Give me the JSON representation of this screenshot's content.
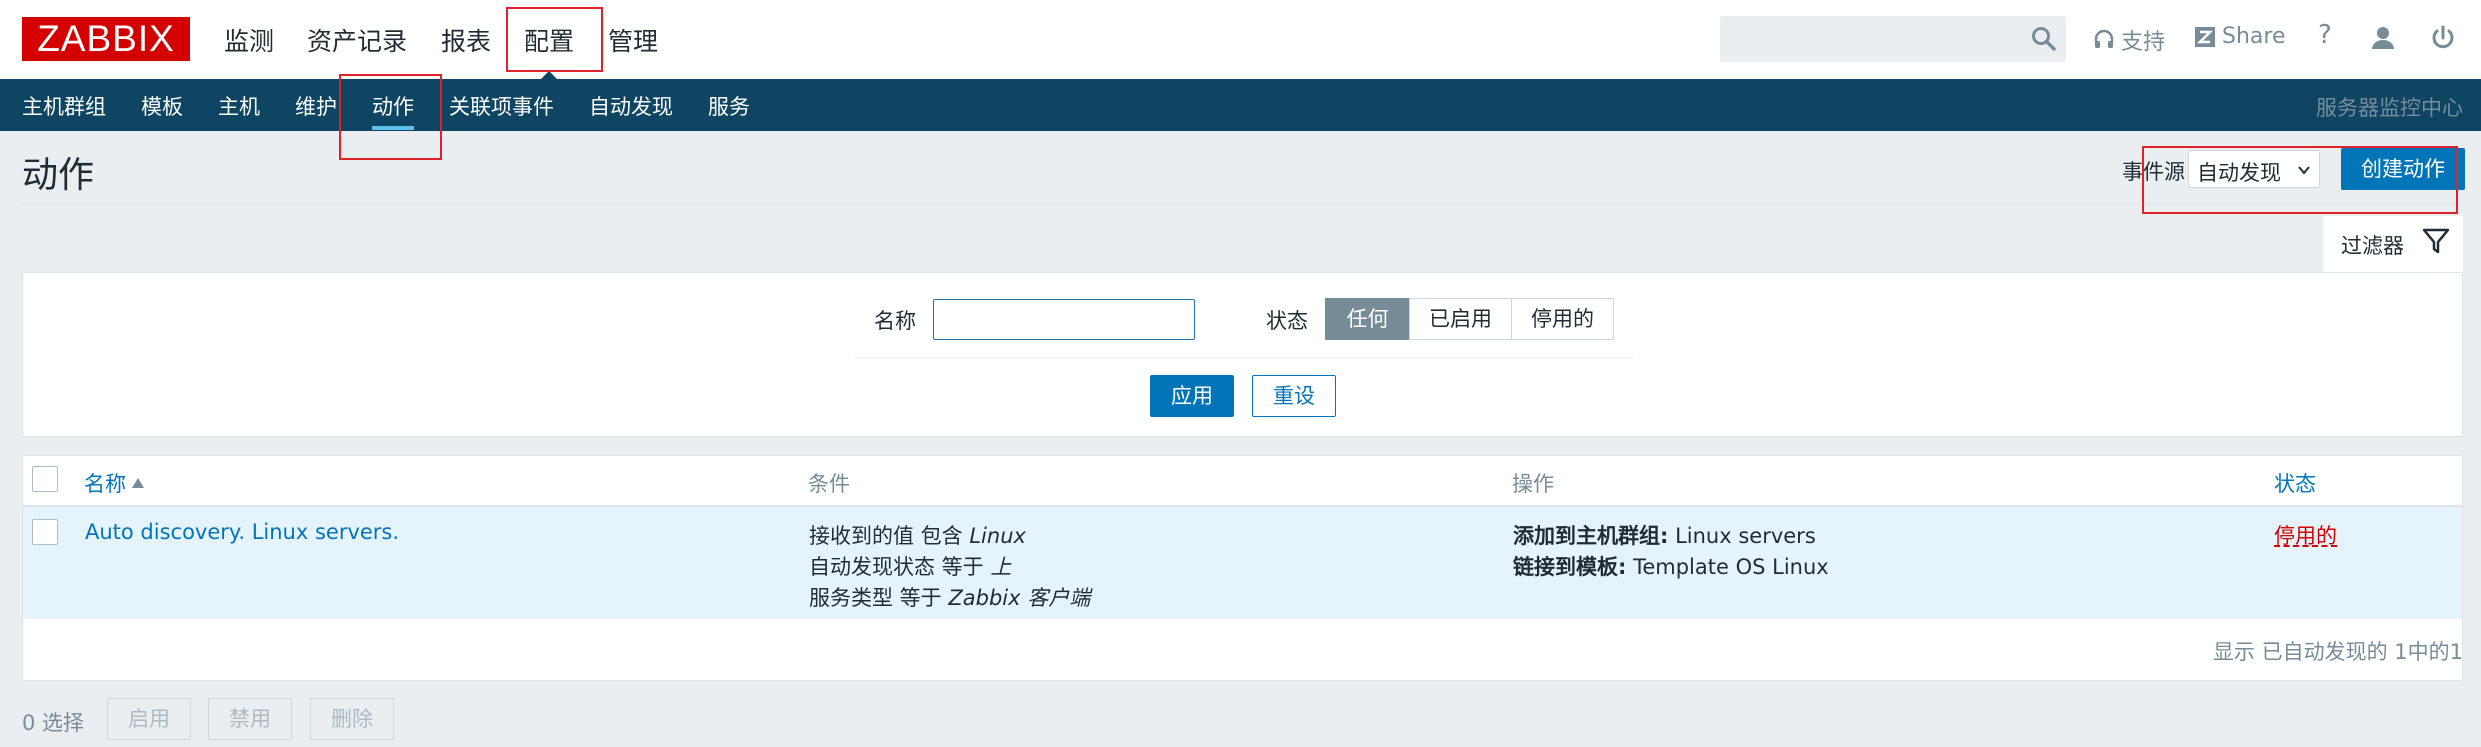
{
  "header": {
    "logo": "ZABBIX",
    "menu": [
      "监测",
      "资产记录",
      "报表",
      "配置",
      "管理"
    ],
    "selected_menu": "配置",
    "support_label": "支持",
    "share_label": "Share",
    "help_label": "?"
  },
  "subnav": {
    "items": [
      "主机群组",
      "模板",
      "主机",
      "维护",
      "动作",
      "关联项事件",
      "自动发现",
      "服务"
    ],
    "selected": "动作",
    "server_name": "服务器监控中心"
  },
  "page": {
    "title": "动作",
    "event_source_label": "事件源",
    "event_source_value": "自动发现",
    "create_button": "创建动作"
  },
  "filter": {
    "tab_label": "过滤器",
    "name_label": "名称",
    "name_value": "",
    "status_label": "状态",
    "status_options": [
      "任何",
      "已启用",
      "停用的"
    ],
    "status_selected": "任何",
    "apply_label": "应用",
    "reset_label": "重设"
  },
  "table": {
    "columns": [
      "名称",
      "条件",
      "操作",
      "状态"
    ],
    "rows": [
      {
        "name": "Auto discovery. Linux servers.",
        "conditions": [
          {
            "text": "接收到的值 包含 ",
            "value": "Linux"
          },
          {
            "text": "自动发现状态 等于 ",
            "value": "上"
          },
          {
            "text": "服务类型 等于 ",
            "value": "Zabbix 客户端"
          }
        ],
        "operations": [
          {
            "label": "添加到主机群组:",
            "value": " Linux servers"
          },
          {
            "label": "链接到模板:",
            "value": " Template OS Linux"
          }
        ],
        "status": "停用的"
      }
    ],
    "footer": "显示 已自动发现的 1中的1"
  },
  "actions": {
    "selected_count": "0 选择",
    "enable_label": "启用",
    "disable_label": "禁用",
    "delete_label": "删除"
  },
  "colors": {
    "brand_red": "#d40000",
    "nav_blue": "#0e4563",
    "accent_blue": "#0275b8",
    "annotation_red": "#e0232b"
  }
}
